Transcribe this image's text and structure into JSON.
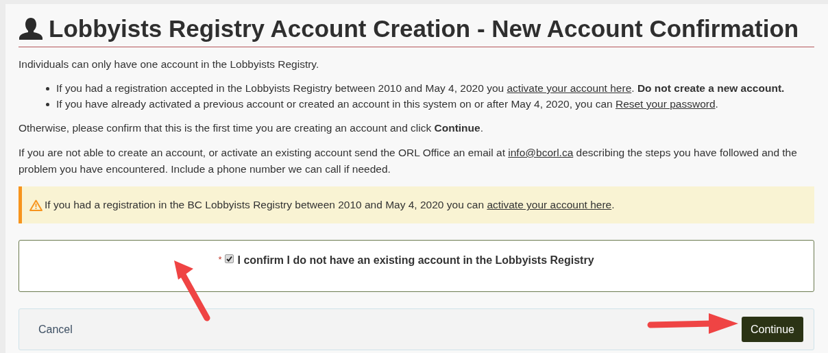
{
  "title": "Lobbyists Registry Account Creation - New Account Confirmation",
  "intro": [
    {
      "kind": "text",
      "text": "Individuals can only have one account in the Lobbyists Registry."
    }
  ],
  "bullets": [
    [
      {
        "kind": "text",
        "text": "If you had a registration accepted in the Lobbyists Registry between 2010 and May 4, 2020 you "
      },
      {
        "kind": "link",
        "text": "activate your account here"
      },
      {
        "kind": "text",
        "text": ". "
      },
      {
        "kind": "bold",
        "text": "Do not create a new account."
      }
    ],
    [
      {
        "kind": "text",
        "text": "If you have already activated a previous account or created an account in this system on or after May 4, 2020, you can "
      },
      {
        "kind": "link",
        "text": "Reset your password"
      },
      {
        "kind": "text",
        "text": "."
      }
    ]
  ],
  "paragraphs": [
    [
      {
        "kind": "text",
        "text": "Otherwise, please confirm that this is the first time you are creating an account and click "
      },
      {
        "kind": "bold",
        "text": "Continue"
      },
      {
        "kind": "text",
        "text": "."
      }
    ],
    [
      {
        "kind": "text",
        "text": "If you are not able to create an account, or activate an existing account send the ORL Office an email at "
      },
      {
        "kind": "link",
        "text": "info@bcorl.ca"
      },
      {
        "kind": "text",
        "text": " describing the steps you have followed and the problem you have encountered. Include a phone number we can call if needed."
      }
    ]
  ],
  "alert": [
    {
      "kind": "text",
      "text": "If you had a registration in the BC Lobbyists Registry between 2010 and May 4, 2020 you can "
    },
    {
      "kind": "link",
      "text": "activate your account here"
    },
    {
      "kind": "text",
      "text": "."
    }
  ],
  "confirm": {
    "required_mark": "*",
    "label": "I confirm I do not have an existing account in the Lobbyists Registry",
    "checked": true
  },
  "cancel": "Cancel",
  "continue": "Continue"
}
